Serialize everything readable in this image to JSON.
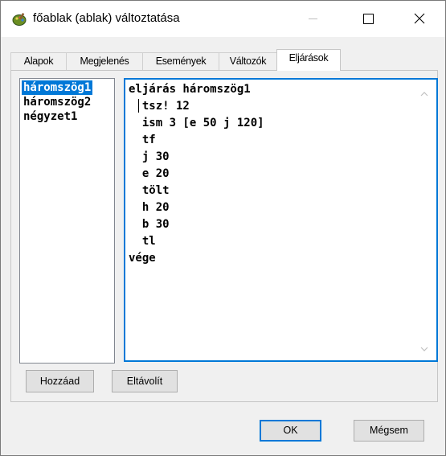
{
  "window": {
    "title": "főablak (ablak) változtatása",
    "icon": "paint-palette-icon"
  },
  "tabs": [
    {
      "label": "Alapok",
      "active": false
    },
    {
      "label": "Megjelenés",
      "active": false
    },
    {
      "label": "Események",
      "active": false
    },
    {
      "label": "Változók",
      "active": false
    },
    {
      "label": "Eljárások",
      "active": true
    }
  ],
  "procedures": [
    {
      "name": "háromszög1",
      "selected": true
    },
    {
      "name": "háromszög2",
      "selected": false
    },
    {
      "name": "négyzet1",
      "selected": false
    }
  ],
  "editor": {
    "lines": [
      "eljárás háromszög1",
      "  tsz! 12",
      "  ism 3 [e 50 j 120]",
      "  tf",
      "  j 30",
      "  e 20",
      "  tölt",
      "  h 20",
      "  b 30",
      "  tl",
      "vége"
    ]
  },
  "buttons": {
    "add": "Hozzáad",
    "remove": "Eltávolít",
    "ok": "OK",
    "cancel": "Mégsem"
  },
  "colors": {
    "accent": "#0078d7",
    "selection": "#0078d7"
  }
}
